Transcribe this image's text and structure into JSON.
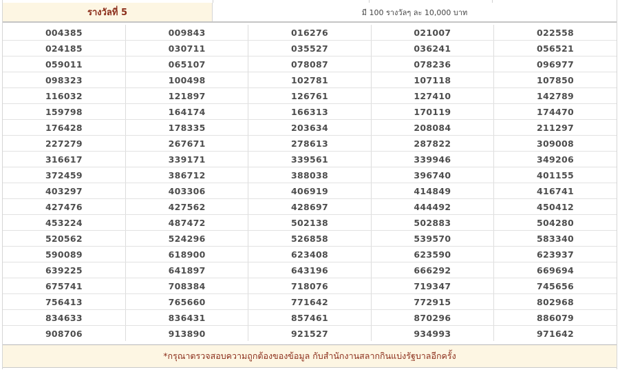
{
  "prize": {
    "title": "รางวัลที่ 5",
    "description": "มี 100 รางวัลๆ ละ 10,000 บาท"
  },
  "numbers": [
    [
      "004385",
      "009843",
      "016276",
      "021007",
      "022558"
    ],
    [
      "024185",
      "030711",
      "035527",
      "036241",
      "056521"
    ],
    [
      "059011",
      "065107",
      "078087",
      "078236",
      "096977"
    ],
    [
      "098323",
      "100498",
      "102781",
      "107118",
      "107850"
    ],
    [
      "116032",
      "121897",
      "126761",
      "127410",
      "142789"
    ],
    [
      "159798",
      "164174",
      "166313",
      "170119",
      "174470"
    ],
    [
      "176428",
      "178335",
      "203634",
      "208084",
      "211297"
    ],
    [
      "227279",
      "267671",
      "278613",
      "287822",
      "309008"
    ],
    [
      "316617",
      "339171",
      "339561",
      "339946",
      "349206"
    ],
    [
      "372459",
      "386712",
      "388038",
      "396740",
      "401155"
    ],
    [
      "403297",
      "403306",
      "406919",
      "414849",
      "416741"
    ],
    [
      "427476",
      "427562",
      "428697",
      "444492",
      "450412"
    ],
    [
      "453224",
      "487472",
      "502138",
      "502883",
      "504280"
    ],
    [
      "520562",
      "524296",
      "526858",
      "539570",
      "583340"
    ],
    [
      "590089",
      "618900",
      "623408",
      "623590",
      "623937"
    ],
    [
      "639225",
      "641897",
      "643196",
      "666292",
      "669694"
    ],
    [
      "675741",
      "708384",
      "718076",
      "719347",
      "745656"
    ],
    [
      "756413",
      "765660",
      "771642",
      "772915",
      "802968"
    ],
    [
      "834633",
      "836431",
      "857461",
      "870296",
      "886079"
    ],
    [
      "908706",
      "913890",
      "921527",
      "934993",
      "971642"
    ]
  ],
  "footer": {
    "note": "*กรุณาตรวจสอบความถูกต้องของข้อมูล กับสำนักงานสลากกินแบ่งรัฐบาลอีกครั้ง"
  },
  "colors": {
    "accent_text": "#8b2d1a",
    "header_bg": "#fdf6e3",
    "number_text": "#4d4d4d"
  }
}
